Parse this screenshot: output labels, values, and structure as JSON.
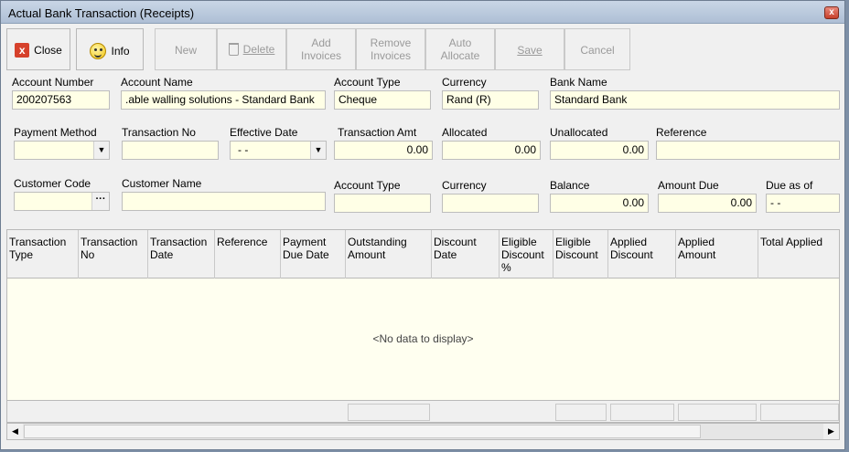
{
  "window": {
    "title": "Actual Bank Transaction (Receipts)",
    "close_glyph": "x"
  },
  "toolbar": {
    "close": "Close",
    "info": "Info",
    "new": "New",
    "delete": "Delete",
    "add_1": "Add",
    "add_2": "Invoices",
    "remove_1": "Remove",
    "remove_2": "Invoices",
    "auto_1": "Auto",
    "auto_2": "Allocate",
    "save": "Save",
    "cancel": "Cancel"
  },
  "account": {
    "number_label": "Account Number",
    "number": "200207563",
    "name_label": "Account Name",
    "name": ".able walling solutions - Standard Bank",
    "type_label": "Account Type",
    "type": "Cheque",
    "currency_label": "Currency",
    "currency": "Rand (R)",
    "bank_label": "Bank Name",
    "bank": "Standard Bank"
  },
  "transaction": {
    "payment_method_label": "Payment Method",
    "payment_method": "",
    "transaction_no_label": "Transaction No",
    "transaction_no": "",
    "effective_date_label": "Effective Date",
    "effective_date": "- -",
    "amt_label": "Transaction Amt",
    "amt": "0.00",
    "allocated_label": "Allocated",
    "allocated": "0.00",
    "unallocated_label": "Unallocated",
    "unallocated": "0.00",
    "reference_label": "Reference",
    "reference": ""
  },
  "customer": {
    "code_label": "Customer Code",
    "code": "",
    "name_label": "Customer Name",
    "name": "",
    "account_type_label": "Account Type",
    "account_type": "",
    "currency_label": "Currency",
    "currency": "",
    "balance_label": "Balance",
    "balance": "0.00",
    "amount_due_label": "Amount Due",
    "amount_due": "0.00",
    "due_as_of_label": "Due as of",
    "due_as_of": "- -"
  },
  "grid": {
    "columns": [
      [
        "Transaction",
        "Type",
        ""
      ],
      [
        "Transaction",
        "No",
        ""
      ],
      [
        "Transaction",
        "Date",
        ""
      ],
      [
        "Reference",
        "",
        ""
      ],
      [
        "Payment",
        "Due Date",
        ""
      ],
      [
        "Outstanding",
        "Amount",
        ""
      ],
      [
        "Discount",
        "Date",
        ""
      ],
      [
        "Eligible",
        "Discount",
        "%"
      ],
      [
        "Eligible",
        "Discount",
        ""
      ],
      [
        "Applied",
        "Discount",
        ""
      ],
      [
        "Applied",
        "Amount",
        ""
      ],
      [
        "Total Applied",
        "",
        ""
      ]
    ],
    "empty_text": "<No data to display>"
  },
  "scroll": {
    "left_glyph": "◀",
    "right_glyph": "▶"
  },
  "glyphs": {
    "dropdown": "▼",
    "ellipsis": "···"
  }
}
